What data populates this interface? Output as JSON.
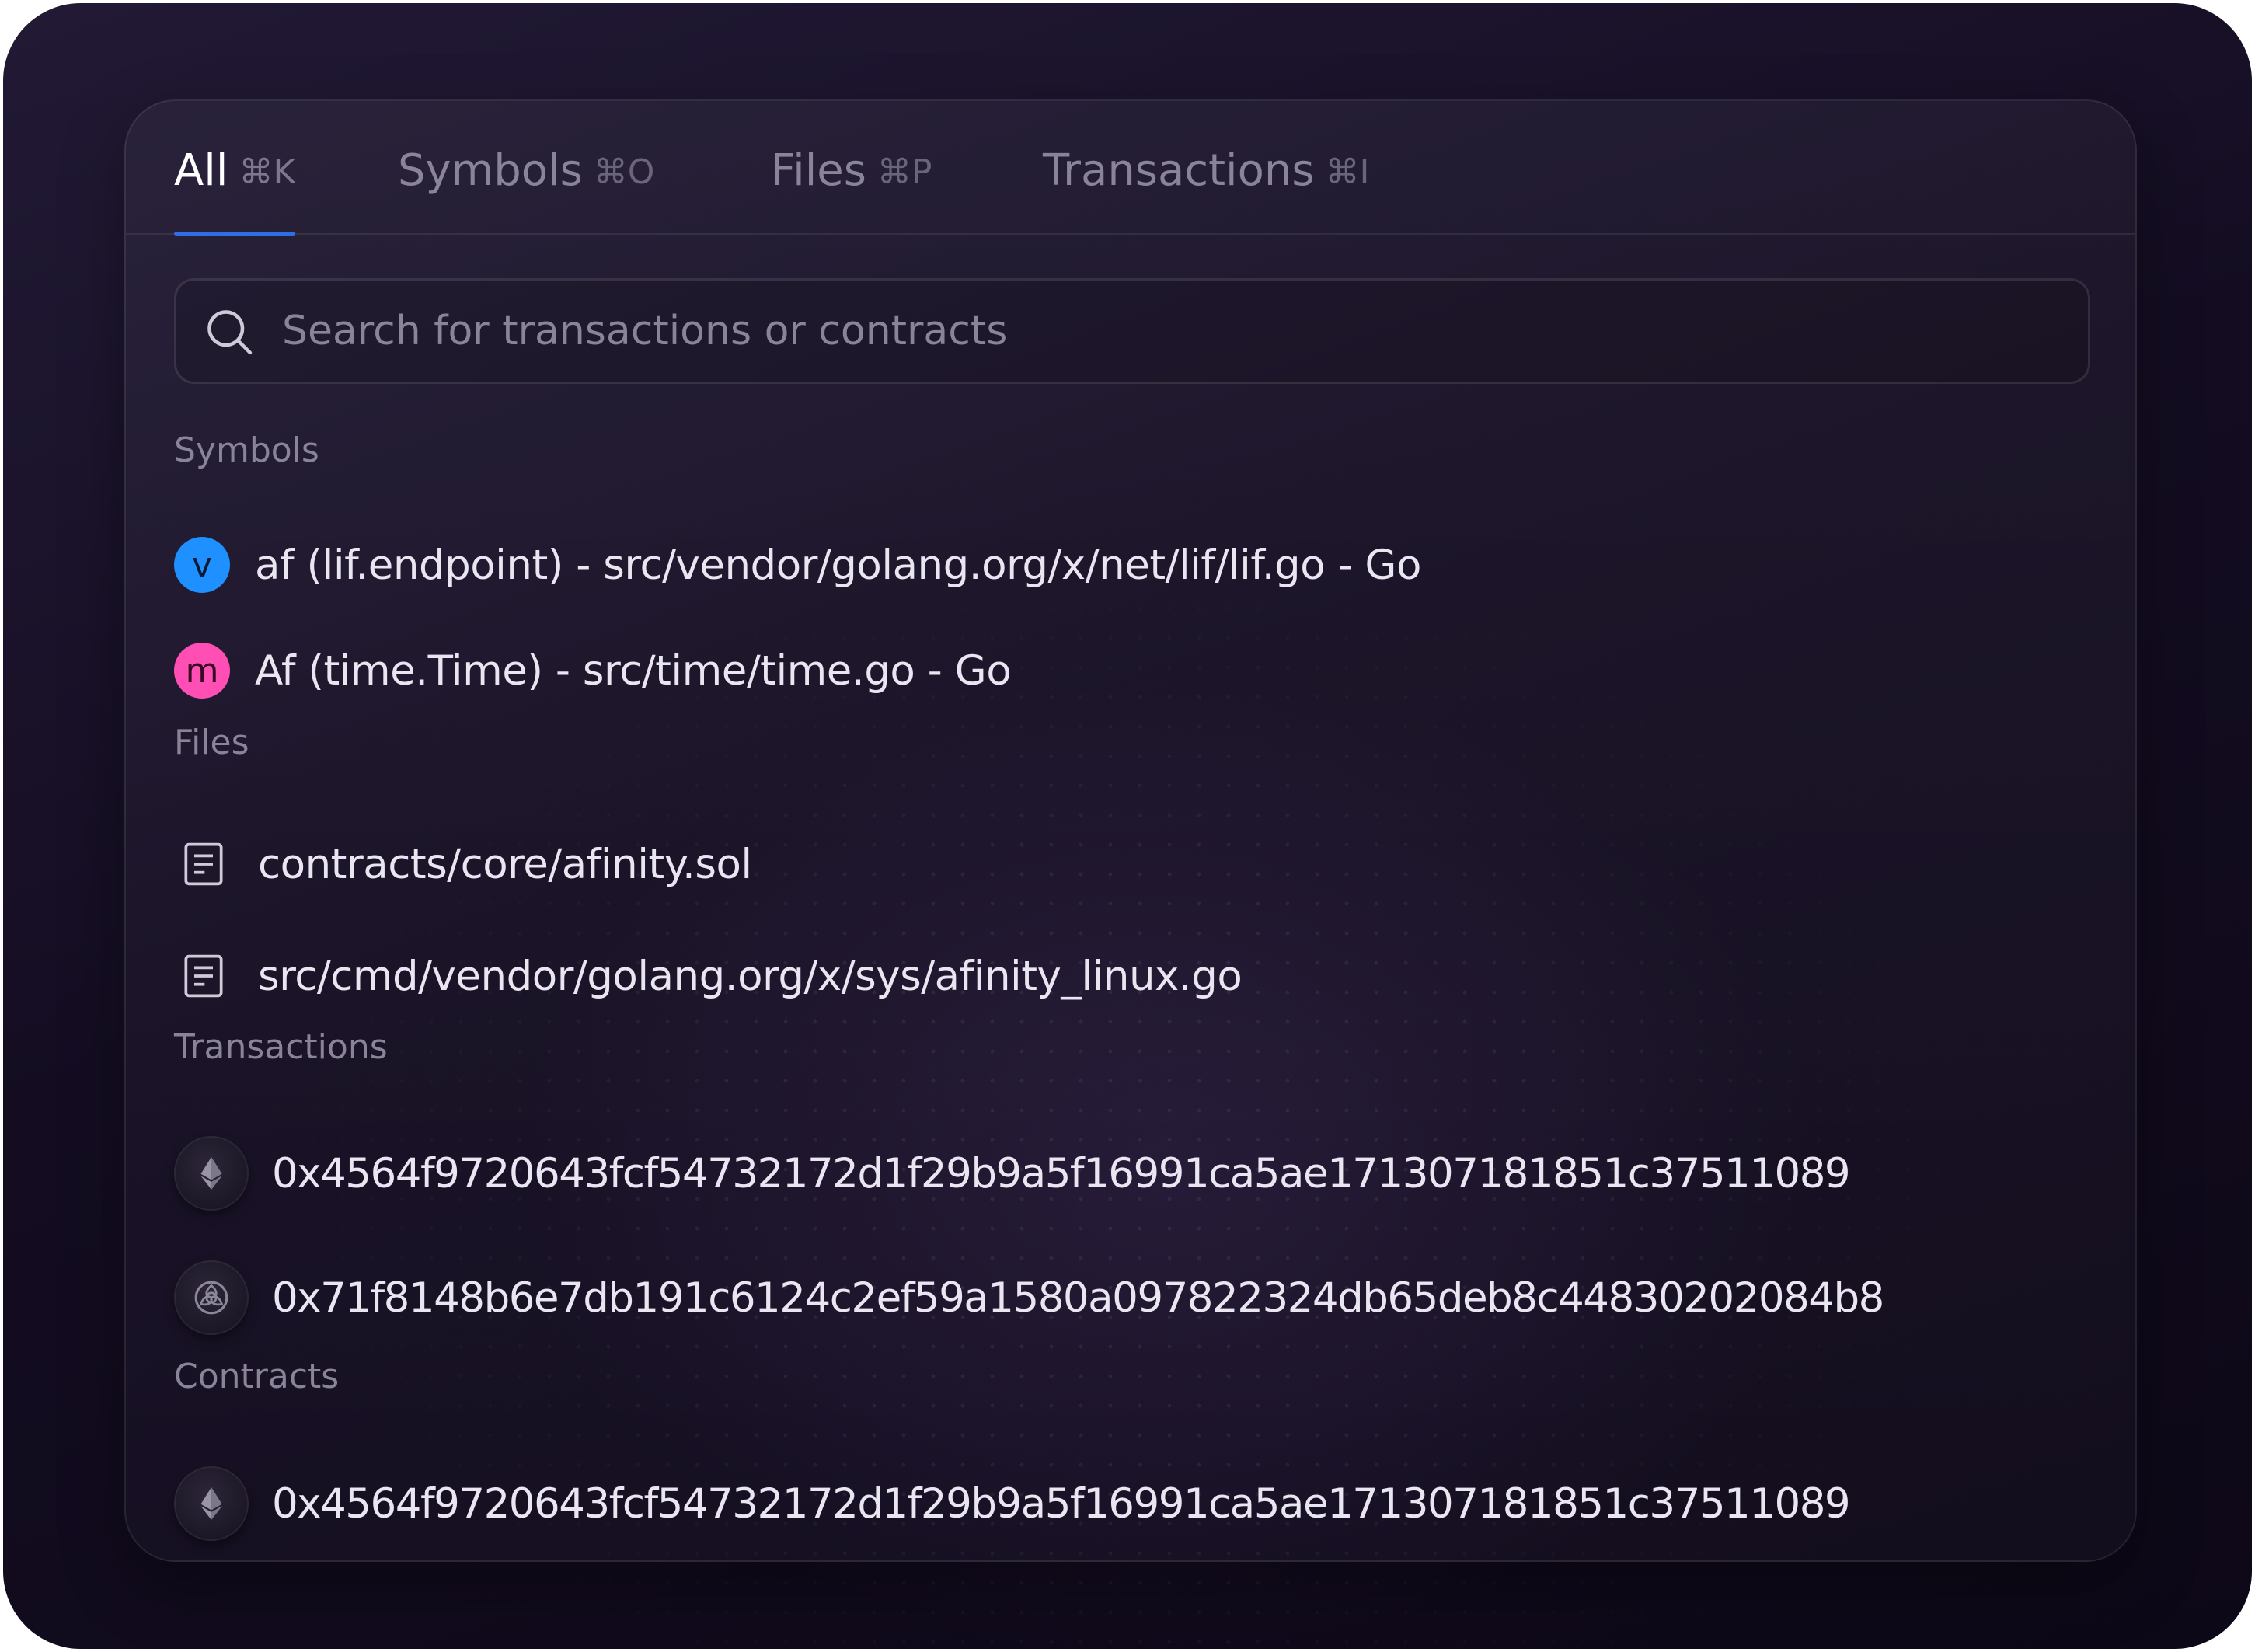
{
  "tabs": [
    {
      "label": "All",
      "shortcut": "⌘K",
      "active": true
    },
    {
      "label": "Symbols",
      "shortcut": "⌘O",
      "active": false
    },
    {
      "label": "Files",
      "shortcut": "⌘P",
      "active": false
    },
    {
      "label": "Transactions",
      "shortcut": "⌘I",
      "active": false
    }
  ],
  "search": {
    "placeholder": "Search for transactions or contracts",
    "value": ""
  },
  "sections": {
    "symbols": {
      "title": "Symbols",
      "items": [
        {
          "badge": "v",
          "text": "af (lif.endpoint) - src/vendor/golang.org/x/net/lif/lif.go - Go"
        },
        {
          "badge": "m",
          "text": "Af (time.Time) - src/time/time.go - Go"
        }
      ]
    },
    "files": {
      "title": "Files",
      "items": [
        {
          "icon": "document-icon",
          "text": "contracts/core/afinity.sol"
        },
        {
          "icon": "document-icon",
          "text": "src/cmd/vendor/golang.org/x/sys/afinity_linux.go"
        }
      ]
    },
    "transactions": {
      "title": "Transactions",
      "items": [
        {
          "icon": "ethereum-icon",
          "text": "0x4564f9720643fcf54732172d1f29b9a5f16991ca5ae171307181851c37511089"
        },
        {
          "icon": "trefoil-token-icon",
          "text": "0x71f8148b6e7db191c6124c2ef59a1580a097822324db65deb8c44830202084b8"
        }
      ]
    },
    "contracts": {
      "title": "Contracts",
      "items": [
        {
          "icon": "ethereum-icon",
          "text": "0x4564f9720643fcf54732172d1f29b9a5f16991ca5ae171307181851c37511089"
        }
      ]
    }
  },
  "colors": {
    "accent": "#2f6fe6",
    "badge_v": "#1e90ff",
    "badge_m": "#ff4fb4",
    "background": "#140d22"
  }
}
